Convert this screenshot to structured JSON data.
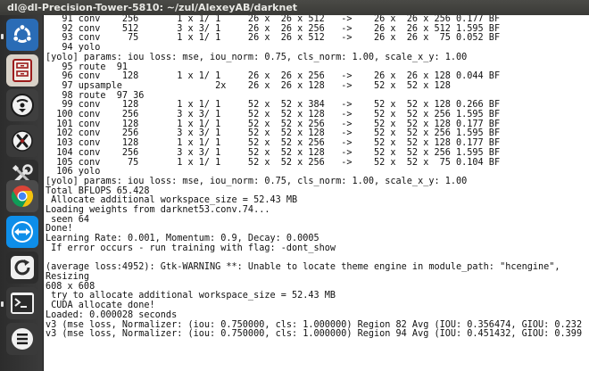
{
  "window": {
    "title": "dl@dl-Precision-Tower-5810: ~/zul/AlexeyAB/darknet"
  },
  "launcher": {
    "items": [
      {
        "name": "dash-home",
        "icon": "ubuntu-logo-icon"
      },
      {
        "name": "files",
        "icon": "file-cabinet-icon"
      },
      {
        "name": "disk-utility",
        "icon": "disk-icon"
      },
      {
        "name": "settings",
        "icon": "tools-icon"
      },
      {
        "name": "system-tools",
        "icon": "wrench-screwdriver-icon"
      },
      {
        "name": "chrome",
        "icon": "chrome-icon"
      },
      {
        "name": "teamviewer",
        "icon": "teamviewer-icon"
      },
      {
        "name": "updater",
        "icon": "refresh-icon"
      },
      {
        "name": "terminal",
        "icon": "terminal-icon"
      },
      {
        "name": "monitor",
        "icon": "list-icon"
      }
    ],
    "colors": {
      "chrome_red": "#db4437",
      "chrome_yellow": "#f4c20d",
      "chrome_green": "#0f9d58",
      "chrome_blue": "#4285f4",
      "teamviewer_blue": "#0e8ee9",
      "ubuntu_blue": "#2a6cb6"
    }
  },
  "terminal": {
    "lines": [
      "   91 conv    256       1 x 1/ 1     26 x  26 x 512   ->    26 x  26 x 256 0.177 BF",
      "   92 conv    512       3 x 3/ 1     26 x  26 x 256   ->    26 x  26 x 512 1.595 BF",
      "   93 conv     75       1 x 1/ 1     26 x  26 x 512   ->    26 x  26 x  75 0.052 BF",
      "   94 yolo",
      "[yolo] params: iou loss: mse, iou_norm: 0.75, cls_norm: 1.00, scale_x_y: 1.00",
      "   95 route  91",
      "   96 conv    128       1 x 1/ 1     26 x  26 x 256   ->    26 x  26 x 128 0.044 BF",
      "   97 upsample                 2x    26 x  26 x 128   ->    52 x  52 x 128",
      "   98 route  97 36",
      "   99 conv    128       1 x 1/ 1     52 x  52 x 384   ->    52 x  52 x 128 0.266 BF",
      "  100 conv    256       3 x 3/ 1     52 x  52 x 128   ->    52 x  52 x 256 1.595 BF",
      "  101 conv    128       1 x 1/ 1     52 x  52 x 256   ->    52 x  52 x 128 0.177 BF",
      "  102 conv    256       3 x 3/ 1     52 x  52 x 128   ->    52 x  52 x 256 1.595 BF",
      "  103 conv    128       1 x 1/ 1     52 x  52 x 256   ->    52 x  52 x 128 0.177 BF",
      "  104 conv    256       3 x 3/ 1     52 x  52 x 128   ->    52 x  52 x 256 1.595 BF",
      "  105 conv     75       1 x 1/ 1     52 x  52 x 256   ->    52 x  52 x  75 0.104 BF",
      "  106 yolo",
      "[yolo] params: iou loss: mse, iou_norm: 0.75, cls_norm: 1.00, scale_x_y: 1.00",
      "Total BFLOPS 65.428",
      " Allocate additional workspace_size = 52.43 MB",
      "Loading weights from darknet53.conv.74...",
      " seen 64",
      "Done!",
      "Learning Rate: 0.001, Momentum: 0.9, Decay: 0.0005",
      " If error occurs - run training with flag: -dont_show",
      "",
      "(average loss:4952): Gtk-WARNING **: Unable to locate theme engine in module_path: \"hcengine\",",
      "Resizing",
      "608 x 608",
      " try to allocate additional workspace_size = 52.43 MB",
      " CUDA allocate done!",
      "Loaded: 0.000028 seconds",
      "v3 (mse loss, Normalizer: (iou: 0.750000, cls: 1.000000) Region 82 Avg (IOU: 0.356474, GIOU: 0.232",
      "v3 (mse loss, Normalizer: (iou: 0.750000, cls: 1.000000) Region 94 Avg (IOU: 0.451432, GIOU: 0.399"
    ]
  }
}
